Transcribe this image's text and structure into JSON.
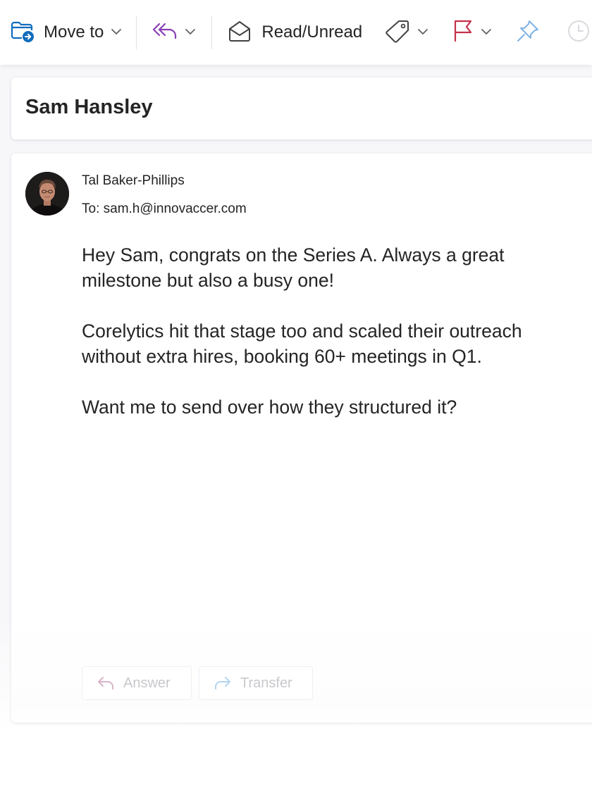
{
  "toolbar": {
    "move_to_label": "Move to",
    "read_unread_label": "Read/Unread"
  },
  "message": {
    "subject": "Sam Hansley",
    "sender_name": "Tal Baker-Phillips",
    "to_line": "To: sam.h@innovaccer.com",
    "body": [
      "Hey Sam, congrats on the Series A. Always a great milestone but also a busy one!",
      "Corelytics hit that stage too and scaled their outreach without extra hires, booking 60+ meetings in Q1.",
      "Want me to send over how they structured it?"
    ]
  },
  "actions": {
    "answer_label": "Answer",
    "transfer_label": "Transfer"
  },
  "icons": {
    "move_to": "folder-arrow-icon",
    "reply_all": "reply-all-icon",
    "read_unread": "envelope-open-icon",
    "tag": "tag-icon",
    "flag": "flag-icon",
    "pin": "pin-icon",
    "clock": "clock-icon",
    "answer": "reply-arrow-icon",
    "transfer": "forward-arrow-icon"
  },
  "colors": {
    "accent_blue": "#0f6cbd",
    "reply_purple": "#8a3fb5",
    "flag_red": "#c4314b",
    "pin_blue": "#7fb3e6",
    "answer_icon": "#d8b4c8",
    "transfer_icon": "#b3d4ee"
  }
}
